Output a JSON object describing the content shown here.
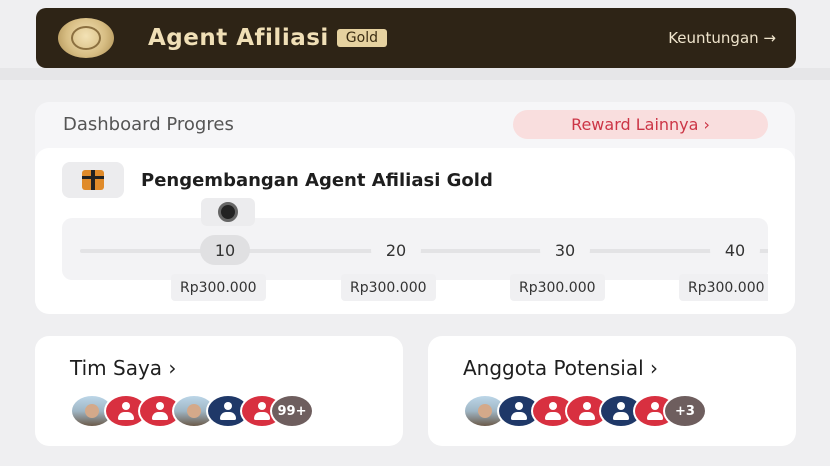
{
  "banner": {
    "title": "Agent Afiliasi",
    "tier": "Gold",
    "link": "Keuntungan →"
  },
  "dashboard": {
    "title": "Dashboard Progres",
    "reward_button": "Reward Lainnya ›",
    "section_title": "Pengembangan Agent Afiliasi Gold",
    "levels": [
      "10",
      "20",
      "30",
      "40"
    ],
    "rewards": [
      "Rp300.000",
      "Rp300.000",
      "Rp300.000",
      "Rp300.000"
    ]
  },
  "team": {
    "title": "Tim Saya ›",
    "count": "99+"
  },
  "potential": {
    "title": "Anggota Potensial ›",
    "count": "+3"
  },
  "colors": {
    "banner_bg": "#2e2416",
    "accent_gold": "#e6d2a0",
    "reward_red": "#cc3546",
    "avatar_red": "#d83040",
    "avatar_navy": "#1f3868"
  }
}
